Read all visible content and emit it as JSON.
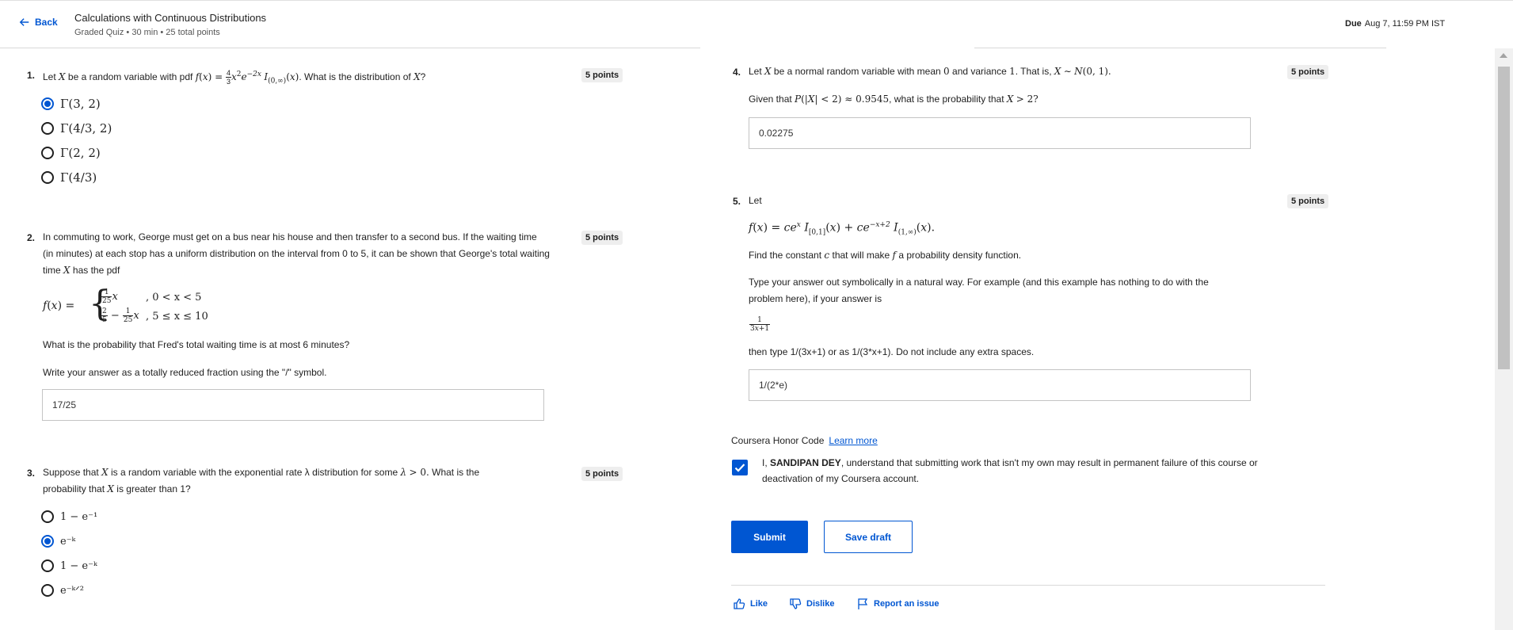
{
  "header": {
    "back_label": "Back",
    "title": "Calculations with Continuous Distributions",
    "subtitle": "Graded Quiz • 30 min • 25 total points",
    "due_label": "Due",
    "due_date": "Aug 7, 11:59 PM IST"
  },
  "q1": {
    "number": "1.",
    "text_prefix": "Let",
    "text_middle": "be a random variable with pdf",
    "text_suffix": ". What is the distribution of",
    "points": "5 points",
    "options": [
      "Γ(3, 2)",
      "Γ(4/3, 2)",
      "Γ(2, 2)",
      "Γ(4/3)"
    ],
    "selected_index": 0
  },
  "q2": {
    "number": "2.",
    "text": "In commuting to work, George must get on a bus near his house and then transfer to a second bus. If the waiting time (in minutes) at each stop has a uniform distribution on the interval from 0 to 5, it can be shown that George's total waiting time",
    "text_end": "has the pdf",
    "points": "5 points",
    "case1_cond": ",   0 < x < 5",
    "case2_cond": ",  5 ≤ x ≤ 10",
    "question": "What is the probability that Fred's total waiting time is at most 6 minutes?",
    "instruction": "Write your answer as a totally reduced fraction using the \"/\" symbol.",
    "answer": "17/25"
  },
  "q3": {
    "number": "3.",
    "text_a": "Suppose that",
    "text_b": "is a random variable with the exponential rate λ distribution for some",
    "text_c": "What is the",
    "text_d": "probability that",
    "text_e": "is greater than 1?",
    "points": "5 points",
    "options": [
      "1 − e⁻¹",
      "e⁻ᵏ",
      "1 − e⁻ᵏ",
      "e⁻ᵏᐟ²"
    ],
    "selected_index": 1
  },
  "q4": {
    "number": "4.",
    "text_a": "Let",
    "text_b": "be a normal random variable with mean",
    "text_c": "and variance",
    "text_d": ". That is,",
    "given_a": "Given that",
    "given_b": ", what is the probability that",
    "points": "5 points",
    "answer": "0.02275"
  },
  "q5": {
    "number": "5.",
    "text": "Let",
    "points": "5 points",
    "find_a": "Find the constant",
    "find_b": "that will make",
    "find_c": "a probability density function.",
    "instruction": "Type your answer out symbolically in a natural way. For example (and this example has nothing to do with the problem here), if your answer is",
    "then_text": "then type 1/(3x+1) or as 1/(3*x+1). Do not include any extra spaces.",
    "answer": "1/(2*e)"
  },
  "honor": {
    "label": "Coursera Honor Code",
    "link": "Learn more",
    "text_pre": "I,",
    "name": "SANDIPAN DEY",
    "text_post": ", understand that submitting work that isn't my own may result in permanent failure of this course or deactivation of my Coursera account."
  },
  "actions": {
    "submit": "Submit",
    "save_draft": "Save draft",
    "like": "Like",
    "dislike": "Dislike",
    "report": "Report an issue"
  },
  "colors": {
    "accent": "#0056d2",
    "points_bg": "#eeeeee"
  }
}
